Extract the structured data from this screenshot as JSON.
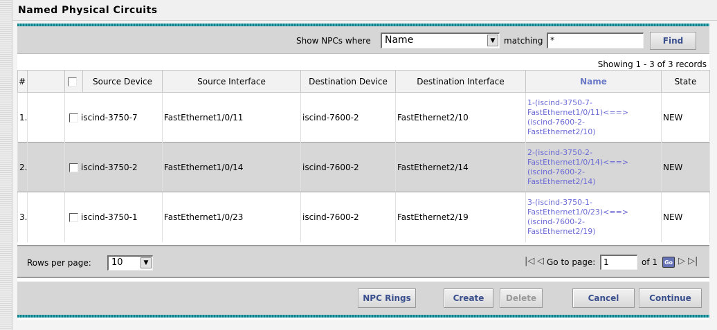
{
  "page": {
    "title": "Named Physical Circuits"
  },
  "filter": {
    "show_label": "Show NPCs where",
    "field_value": "Name",
    "matching_label": "matching",
    "match_value": "*",
    "find_label": "Find"
  },
  "table": {
    "records_text": "Showing 1 - 3 of 3 records",
    "headers": {
      "num": "#",
      "source_device": "Source Device",
      "source_interface": "Source Interface",
      "destination_device": "Destination Device",
      "destination_interface": "Destination Interface",
      "name": "Name",
      "state": "State"
    },
    "rows": [
      {
        "num": "1.",
        "source_device": "iscind-3750-7",
        "source_interface": "FastEthernet1/0/11",
        "destination_device": "iscind-7600-2",
        "destination_interface": "FastEthernet2/10",
        "name_lines": [
          "1-(iscind-3750-7-",
          "FastEthernet1/0/11)<==>",
          "(iscind-7600-2-",
          "FastEthernet2/10)"
        ],
        "state": "NEW"
      },
      {
        "num": "2.",
        "source_device": "iscind-3750-2",
        "source_interface": "FastEthernet1/0/14",
        "destination_device": "iscind-7600-2",
        "destination_interface": "FastEthernet2/14",
        "name_lines": [
          "2-(iscind-3750-2-",
          "FastEthernet1/0/14)<==>",
          "(iscind-7600-2-",
          "FastEthernet2/14)"
        ],
        "state": "NEW"
      },
      {
        "num": "3.",
        "source_device": "iscind-3750-1",
        "source_interface": "FastEthernet1/0/23",
        "destination_device": "iscind-7600-2",
        "destination_interface": "FastEthernet2/19",
        "name_lines": [
          "3-(iscind-3750-1-",
          "FastEthernet1/0/23)<==>",
          "(iscind-7600-2-",
          "FastEthernet2/19)"
        ],
        "state": "NEW"
      }
    ]
  },
  "pager": {
    "rows_per_page_label": "Rows per page:",
    "rows_per_page_value": "10",
    "go_to_label": "Go to page:",
    "page_value": "1",
    "of_label": "of 1",
    "go_label": "Go"
  },
  "actions": {
    "npc_rings": "NPC Rings",
    "create": "Create",
    "delete": "Delete",
    "cancel": "Cancel",
    "continue": "Continue"
  },
  "icons": {
    "first": "first-page-icon",
    "prev": "previous-page-icon",
    "next": "next-page-icon",
    "last": "last-page-icon",
    "dropdown": "chevron-down-icon"
  },
  "colors": {
    "accent_teal": "#117e88",
    "link": "#6a6ad6",
    "button_text": "#3a4f8d"
  }
}
